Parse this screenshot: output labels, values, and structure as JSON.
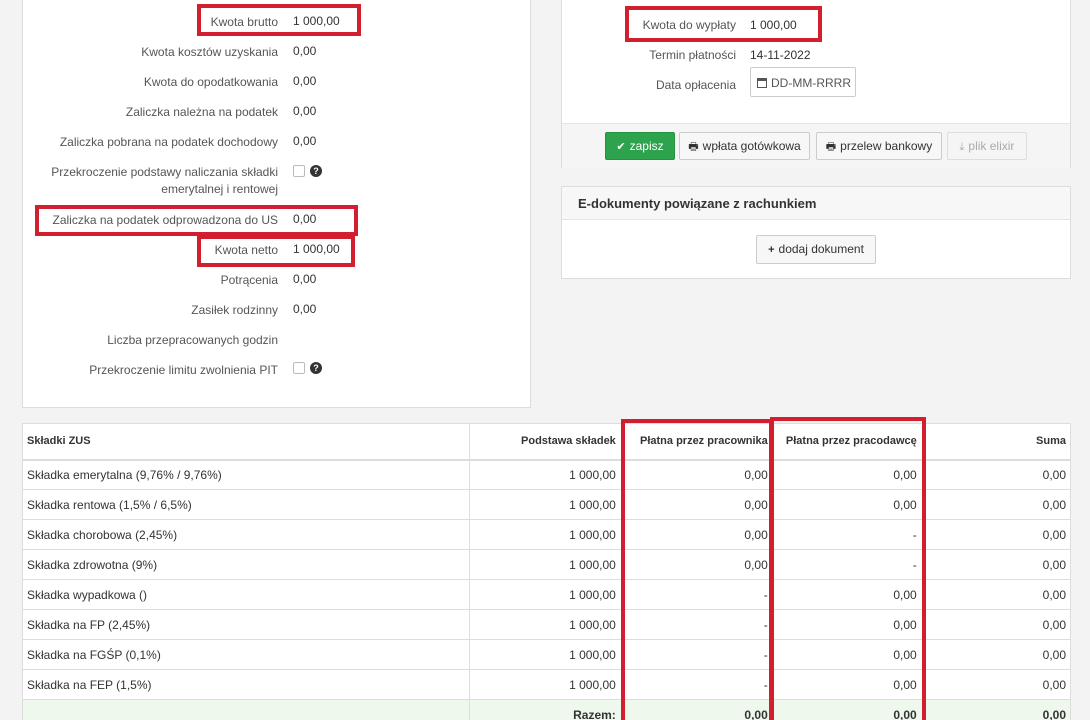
{
  "form": {
    "kwota_brutto": {
      "label": "Kwota brutto",
      "value": "1 000,00"
    },
    "koszty": {
      "label": "Kwota kosztów uzyskania",
      "value": "0,00"
    },
    "opodatkowanie": {
      "label": "Kwota do opodatkowania",
      "value": "0,00"
    },
    "zaliczka_nalezna": {
      "label": "Zaliczka należna na podatek",
      "value": "0,00"
    },
    "zaliczka_pobrana": {
      "label": "Zaliczka pobrana na podatek dochodowy",
      "value": "0,00"
    },
    "przekroczenie_line1": "Przekroczenie podstawy naliczania składki",
    "przekroczenie_line2": "emerytalnej i rentowej",
    "zaliczka_us": {
      "label": "Zaliczka na podatek odprowadzona do US",
      "value": "0,00"
    },
    "kwota_netto": {
      "label": "Kwota netto",
      "value": "1 000,00"
    },
    "potracenia": {
      "label": "Potrącenia",
      "value": "0,00"
    },
    "zasilek": {
      "label": "Zasiłek rodzinny",
      "value": "0,00"
    },
    "godziny": {
      "label": "Liczba przepracowanych godzin",
      "value": ""
    },
    "limit_pit": {
      "label": "Przekroczenie limitu zwolnienia PIT"
    }
  },
  "payment": {
    "kwota_do_wyplaty": {
      "label": "Kwota do wypłaty",
      "value": "1 000,00"
    },
    "termin": {
      "label": "Termin płatności",
      "value": "14-11-2022"
    },
    "data_oplacenia": {
      "label": "Data opłacenia",
      "placeholder": "DD-MM-RRRR"
    }
  },
  "buttons": {
    "save": "zapisz",
    "cash": "wpłata gotówkowa",
    "transfer": "przelew bankowy",
    "elixir": "plik elixir"
  },
  "edocs": {
    "title": "E-dokumenty powiązane z rachunkiem",
    "add": "dodaj dokument"
  },
  "zus_table": {
    "headers": [
      "Składki ZUS",
      "Podstawa składek",
      "Płatna przez pracownika",
      "Płatna przez pracodawcę",
      "Suma"
    ],
    "rows": [
      [
        "Składka emerytalna (9,76% / 9,76%)",
        "1 000,00",
        "0,00",
        "0,00",
        "0,00"
      ],
      [
        "Składka rentowa (1,5% / 6,5%)",
        "1 000,00",
        "0,00",
        "0,00",
        "0,00"
      ],
      [
        "Składka chorobowa (2,45%)",
        "1 000,00",
        "0,00",
        "-",
        "0,00"
      ],
      [
        "Składka zdrowotna (9%)",
        "1 000,00",
        "0,00",
        "-",
        "0,00"
      ],
      [
        "Składka wypadkowa ()",
        "1 000,00",
        "-",
        "0,00",
        "0,00"
      ],
      [
        "Składka na FP (2,45%)",
        "1 000,00",
        "-",
        "0,00",
        "0,00"
      ],
      [
        "Składka na FGŚP (0,1%)",
        "1 000,00",
        "-",
        "0,00",
        "0,00"
      ],
      [
        "Składka na FEP (1,5%)",
        "1 000,00",
        "-",
        "0,00",
        "0,00"
      ]
    ],
    "total": [
      "",
      "Razem:",
      "0,00",
      "0,00",
      "0,00"
    ]
  },
  "colors": {
    "highlight": "#d21f2f",
    "save_button": "#2ea34d"
  }
}
